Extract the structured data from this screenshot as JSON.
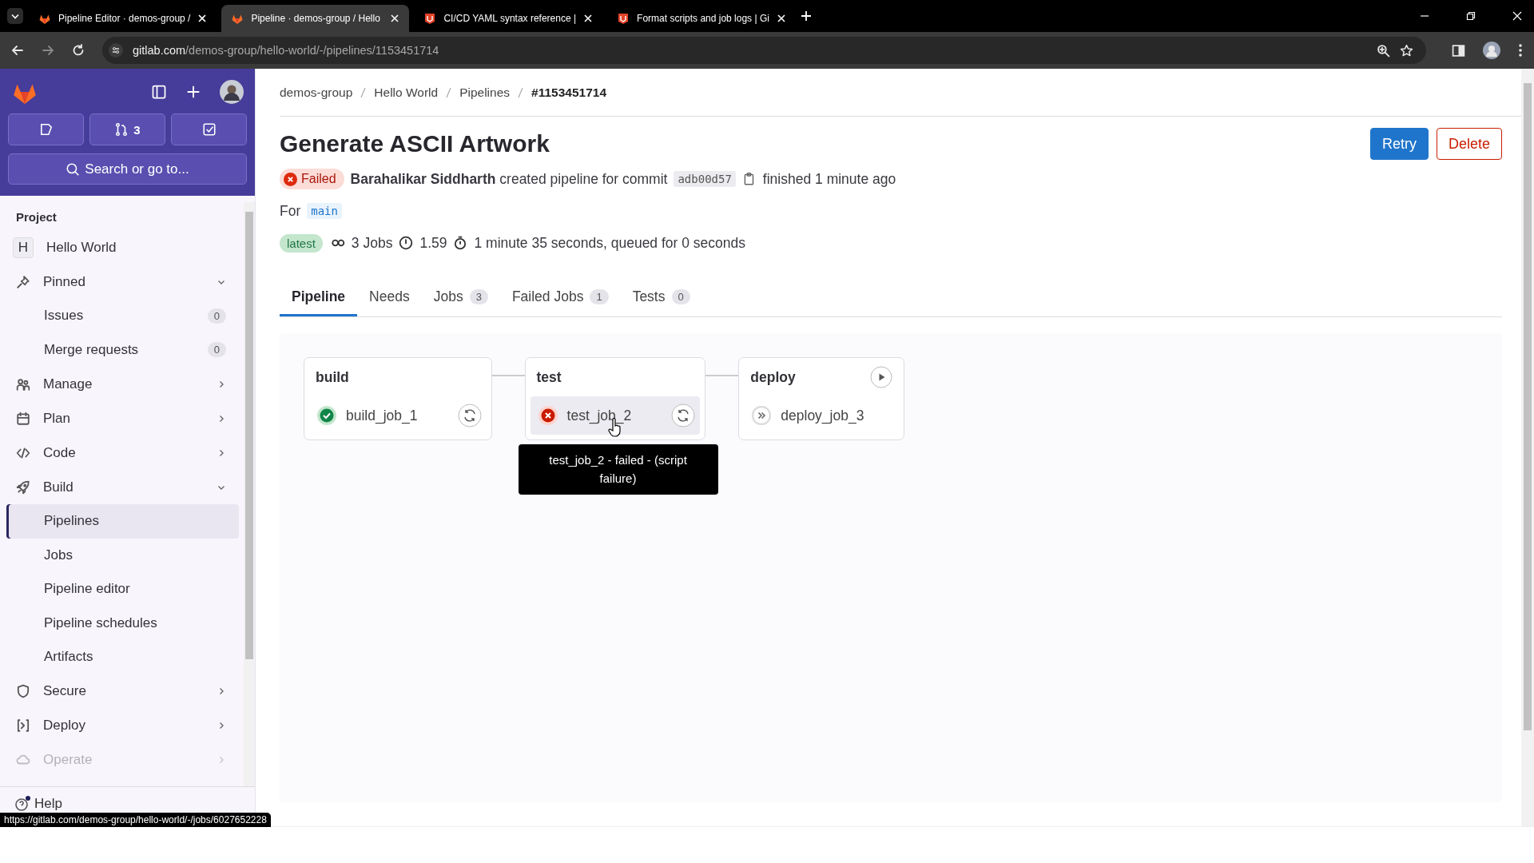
{
  "browser": {
    "tabs": [
      {
        "title": "Pipeline Editor · demos-group /",
        "kind": "fox",
        "selected": false
      },
      {
        "title": "Pipeline · demos-group / Hello",
        "kind": "fox",
        "selected": true
      },
      {
        "title": "CI/CD YAML syntax reference |",
        "kind": "docs",
        "selected": false
      },
      {
        "title": "Format scripts and job logs | Gi",
        "kind": "docs",
        "selected": false
      }
    ],
    "url_host": "gitlab.com",
    "url_path": "/demos-group/hello-world/-/pipelines/1153451714"
  },
  "sidebar": {
    "merge_request_count": "3",
    "search": "Search or go to...",
    "section_label": "Project",
    "project": {
      "initial": "H",
      "name": "Hello World"
    },
    "items": [
      {
        "label": "Pinned",
        "expanded": true,
        "children": [
          {
            "label": "Issues",
            "count": "0",
            "selected": false
          },
          {
            "label": "Merge requests",
            "count": "0",
            "selected": false
          }
        ]
      },
      {
        "label": "Manage",
        "expanded": false
      },
      {
        "label": "Plan",
        "expanded": false
      },
      {
        "label": "Code",
        "expanded": false
      },
      {
        "label": "Build",
        "expanded": true,
        "children": [
          {
            "label": "Pipelines",
            "selected": true
          },
          {
            "label": "Jobs",
            "selected": false
          },
          {
            "label": "Pipeline editor",
            "selected": false
          },
          {
            "label": "Pipeline schedules",
            "selected": false
          },
          {
            "label": "Artifacts",
            "selected": false
          }
        ]
      },
      {
        "label": "Secure",
        "expanded": false
      },
      {
        "label": "Deploy",
        "expanded": false
      },
      {
        "label": "Operate",
        "expanded": false
      }
    ],
    "help": "Help"
  },
  "main": {
    "breadcrumbs": [
      "demos-group",
      "Hello World",
      "Pipelines",
      "#1153451714"
    ],
    "title": "Generate ASCII Artwork",
    "actions": [
      {
        "label": "Retry",
        "kind": "primary"
      },
      {
        "label": "Delete",
        "kind": "danger"
      }
    ],
    "status": {
      "label": "Failed",
      "kind": "failed"
    },
    "summary": "**Barahalikar Siddharth** created pipeline for commit",
    "commit": "adb00d57",
    "finished": "finished 1 minute ago",
    "ref_prefix": "For",
    "ref": "main",
    "badge": "latest",
    "jobs": "3 Jobs",
    "compute": "1.59",
    "duration": "1 minute 35 seconds, queued for 0 seconds",
    "tabs": [
      {
        "label": "Pipeline",
        "selected": true
      },
      {
        "label": "Needs",
        "selected": false
      },
      {
        "label": "Jobs",
        "count": "3",
        "selected": false
      },
      {
        "label": "Failed Jobs",
        "count": "1",
        "selected": false
      },
      {
        "label": "Tests",
        "count": "0",
        "selected": false
      }
    ],
    "stages": [
      {
        "name": "build",
        "playable": false,
        "jobs": [
          {
            "name": "build_job_1",
            "kind": "success",
            "retryable": true,
            "hovered": false
          }
        ]
      },
      {
        "name": "test",
        "playable": false,
        "jobs": [
          {
            "name": "test_job_2",
            "kind": "failed",
            "retryable": true,
            "hovered": true,
            "tooltip": "test_job_2 - failed - (script failure)"
          }
        ]
      },
      {
        "name": "deploy",
        "playable": true,
        "jobs": [
          {
            "name": "deploy_job_3",
            "kind": "skipped",
            "retryable": false,
            "hovered": false
          }
        ]
      }
    ]
  },
  "status_url": "https://gitlab.com/demos-group/hello-world/-/jobs/6027652228"
}
